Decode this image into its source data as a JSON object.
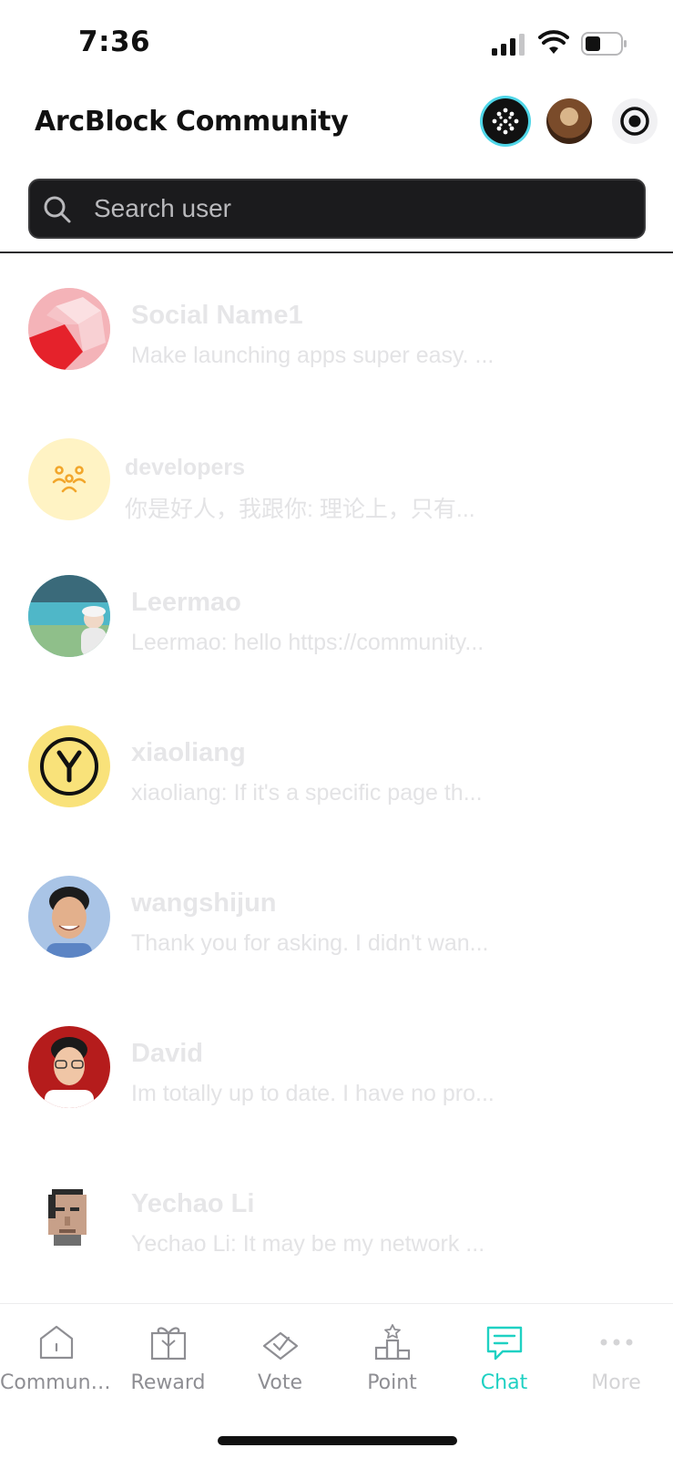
{
  "status_bar": {
    "time": "7:36"
  },
  "header": {
    "title": "ArcBlock Community"
  },
  "search": {
    "placeholder": "Search user"
  },
  "chats": [
    {
      "name": "Social Name1",
      "preview": "Make launching apps super easy. ..."
    },
    {
      "name": "developers",
      "preview": "你是好人，我跟你: 理论上，只有..."
    },
    {
      "name": "Leermao",
      "preview": "Leermao: hello https://community..."
    },
    {
      "name": "xiaoliang",
      "preview": "xiaoliang: If it's a specific page th..."
    },
    {
      "name": "wangshijun",
      "preview": "Thank you for asking. I didn't wan..."
    },
    {
      "name": "David",
      "preview": "Im totally up to date. I have no pro..."
    },
    {
      "name": "Yechao Li",
      "preview": "Yechao Li: It may be my network ..."
    }
  ],
  "tabs": [
    {
      "label": "Communi...",
      "icon": "home-icon"
    },
    {
      "label": "Reward",
      "icon": "gift-icon"
    },
    {
      "label": "Vote",
      "icon": "vote-icon"
    },
    {
      "label": "Point",
      "icon": "podium-icon"
    },
    {
      "label": "Chat",
      "icon": "chat-icon",
      "active": true
    },
    {
      "label": "More",
      "icon": "more-icon"
    }
  ],
  "colors": {
    "accent": "#1fd1c3",
    "search_bg": "#1b1b1d",
    "avatar_y": "#f9e27a",
    "avatar_group": "#fff3c4"
  }
}
